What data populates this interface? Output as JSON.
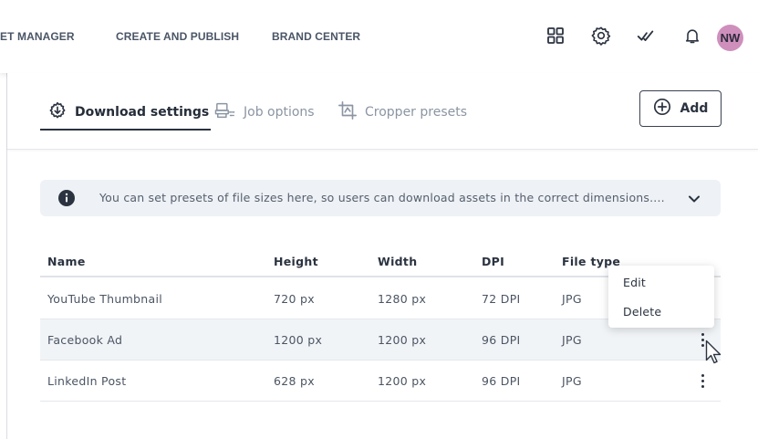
{
  "nav": {
    "items": [
      "ET MANAGER",
      "CREATE AND PUBLISH",
      "BRAND CENTER"
    ],
    "icons": [
      "grid-icon",
      "settings-icon",
      "tasks-check-icon",
      "notification-bell-icon"
    ],
    "avatar": "NW",
    "avatar_color": "#cf8fbd"
  },
  "tabs": [
    {
      "label": "Download settings",
      "icon": "download-settings-icon",
      "active": true
    },
    {
      "label": "Job options",
      "icon": "job-options-icon",
      "active": false
    },
    {
      "label": "Cropper presets",
      "icon": "cropper-icon",
      "active": false
    }
  ],
  "add_button": {
    "label": "Add"
  },
  "banner": {
    "text": "You can set presets of file sizes here, so users can download assets in the correct dimensions...."
  },
  "table": {
    "headers": [
      "Name",
      "Height",
      "Width",
      "DPI",
      "File type"
    ],
    "rows": [
      [
        "YouTube Thumbnail",
        "720 px",
        "1280 px",
        "72 DPI",
        "JPG"
      ],
      [
        "Facebook Ad",
        "1200 px",
        "1200 px",
        "96 DPI",
        "JPG"
      ],
      [
        "LinkedIn Post",
        "628 px",
        "1200 px",
        "96 DPI",
        "JPG"
      ]
    ]
  },
  "row_menu": {
    "items": [
      "Edit",
      "Delete"
    ]
  }
}
